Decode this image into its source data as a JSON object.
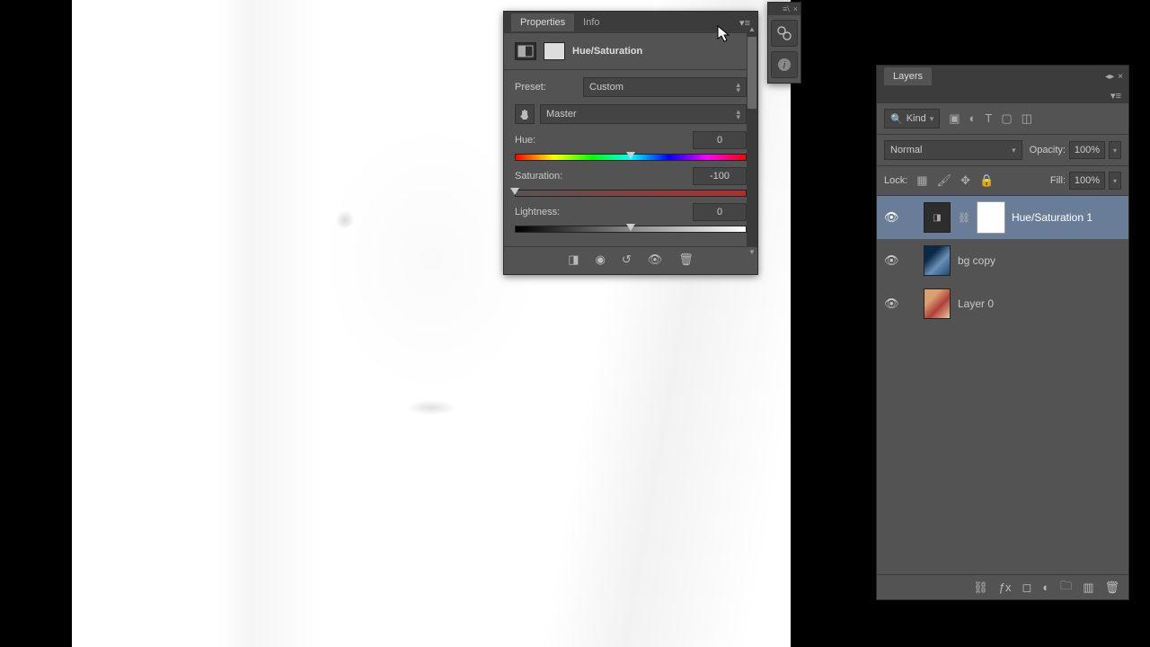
{
  "properties_panel": {
    "tab_properties": "Properties",
    "tab_info": "Info",
    "adjustment_name": "Hue/Saturation",
    "preset_label": "Preset:",
    "preset_value": "Custom",
    "channel_value": "Master",
    "hue_label": "Hue:",
    "hue_value": "0",
    "sat_label": "Saturation:",
    "sat_value": "-100",
    "light_label": "Lightness:",
    "light_value": "0"
  },
  "mini_dock": {
    "icon1": "adjustments-icon",
    "icon2": "info-icon"
  },
  "layers_panel": {
    "tab_layers": "Layers",
    "filter_kind": "Kind",
    "blend_mode": "Normal",
    "opacity_label": "Opacity:",
    "opacity_value": "100%",
    "lock_label": "Lock:",
    "fill_label": "Fill:",
    "fill_value": "100%",
    "items": [
      {
        "name": "Hue/Saturation 1"
      },
      {
        "name": "bg copy"
      },
      {
        "name": "Layer 0"
      }
    ]
  }
}
